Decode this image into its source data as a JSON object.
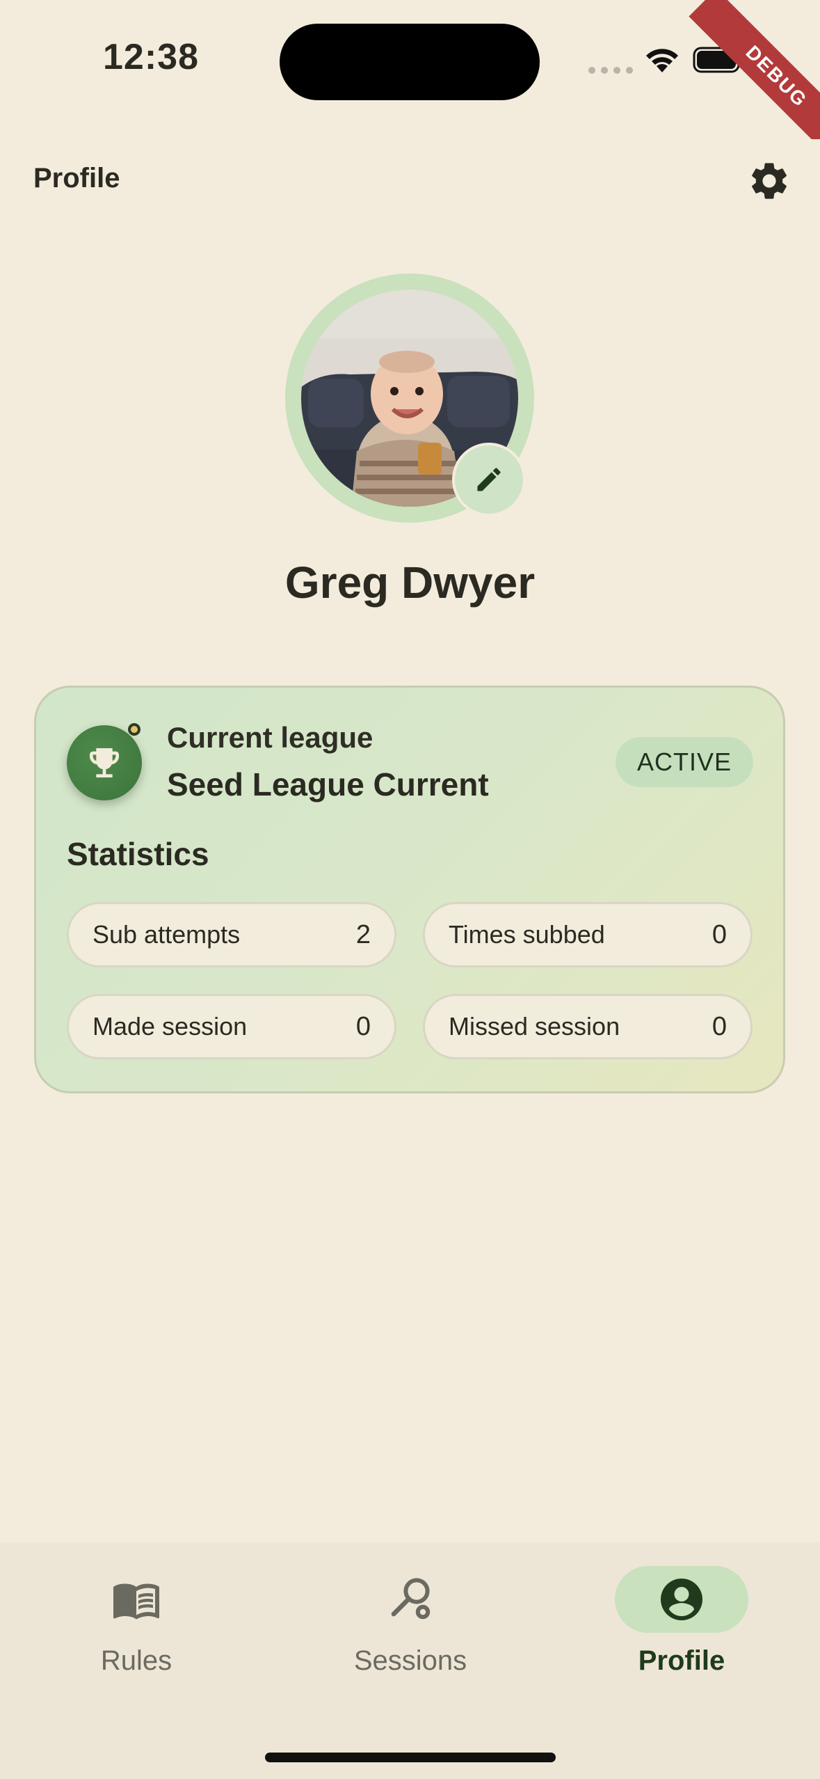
{
  "status_bar": {
    "time": "12:38"
  },
  "debug_banner": "DEBUG",
  "header": {
    "title": "Profile"
  },
  "profile": {
    "name": "Greg Dwyer"
  },
  "league_card": {
    "label": "Current league",
    "name": "Seed League Current",
    "status": "ACTIVE",
    "stats_title": "Statistics",
    "stats": [
      {
        "label": "Sub attempts",
        "value": "2"
      },
      {
        "label": "Times subbed",
        "value": "0"
      },
      {
        "label": "Made session",
        "value": "0"
      },
      {
        "label": "Missed session",
        "value": "0"
      }
    ]
  },
  "bottom_nav": {
    "items": [
      {
        "label": "Rules",
        "icon": "book-icon"
      },
      {
        "label": "Sessions",
        "icon": "racket-icon"
      },
      {
        "label": "Profile",
        "icon": "account-circle-icon",
        "active": true
      }
    ]
  },
  "colors": {
    "background": "#f3ecdc",
    "accent": "#c9e1bd",
    "badge": "#3c7439",
    "active_nav_text": "#1f3a1c"
  }
}
